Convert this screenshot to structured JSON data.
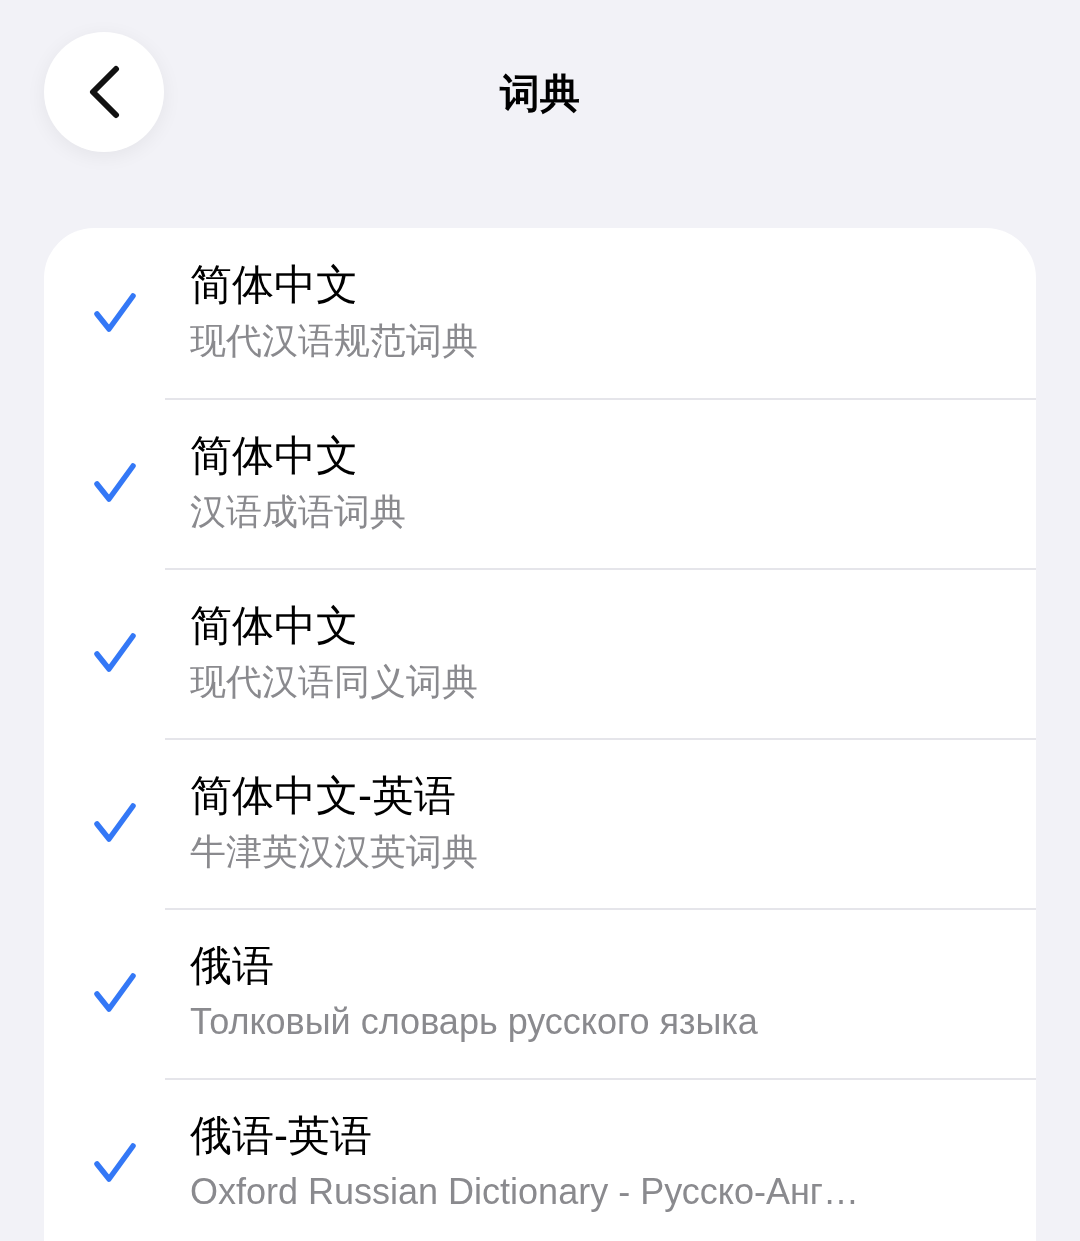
{
  "nav": {
    "title": "词典"
  },
  "dictionaries": [
    {
      "language": "简体中文",
      "name": "现代汉语规范词典",
      "checked": true
    },
    {
      "language": "简体中文",
      "name": "汉语成语词典",
      "checked": true
    },
    {
      "language": "简体中文",
      "name": "现代汉语同义词典",
      "checked": true
    },
    {
      "language": "简体中文-英语",
      "name": "牛津英汉汉英词典",
      "checked": true
    },
    {
      "language": "俄语",
      "name": "Толковый словарь русского языка",
      "checked": true
    },
    {
      "language": "俄语-英语",
      "name": "Oxford Russian Dictionary - Русско-Анг…",
      "checked": true
    }
  ]
}
